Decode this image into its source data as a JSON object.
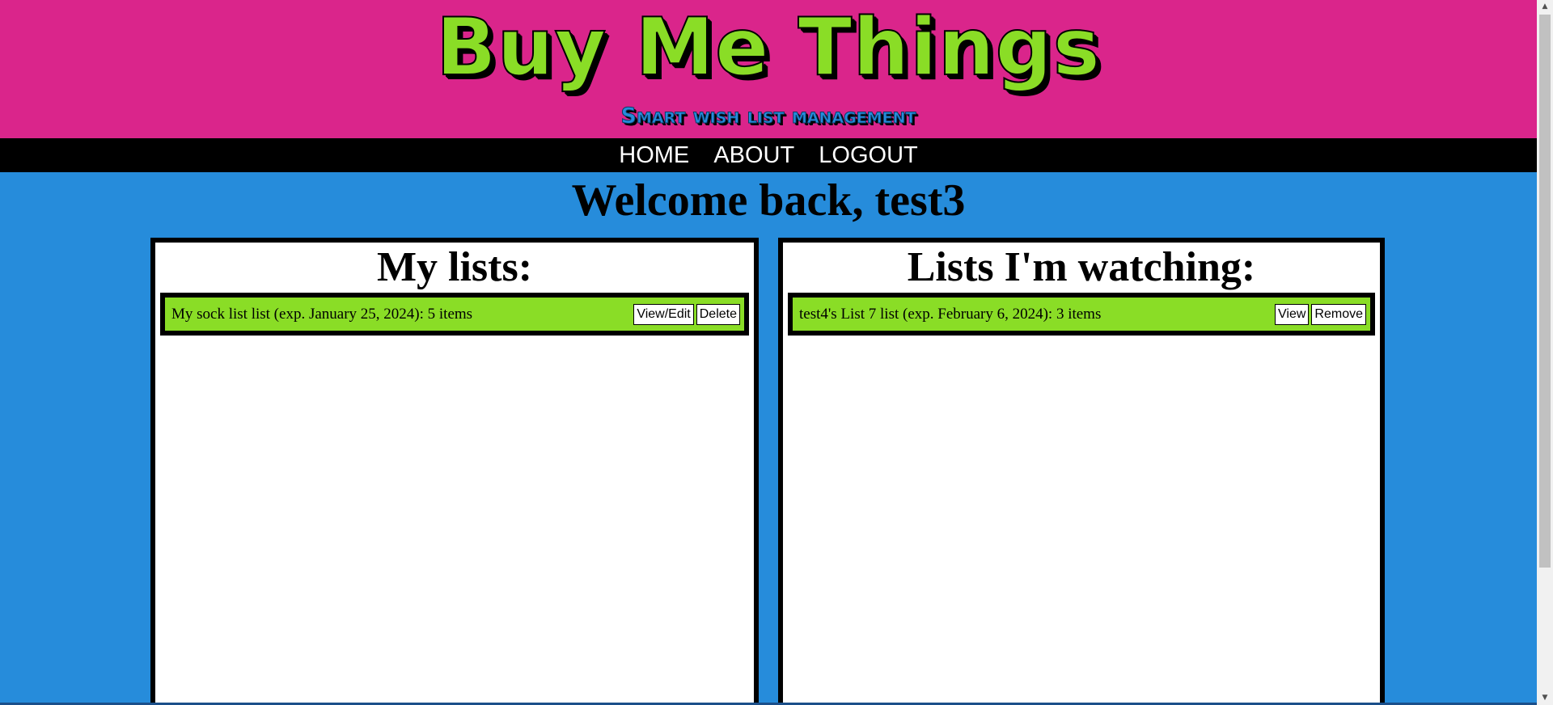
{
  "header": {
    "title": "Buy Me Things",
    "subtitle": "Smart wish list management"
  },
  "nav": {
    "home": "HOME",
    "about": "ABOUT",
    "logout": "LOGOUT"
  },
  "welcome": "Welcome back, test3",
  "my_lists": {
    "heading": "My lists:",
    "items": [
      {
        "text": "My sock list list (exp. January 25, 2024): 5 items",
        "view_edit_label": "View/Edit",
        "delete_label": "Delete"
      }
    ]
  },
  "watching": {
    "heading": "Lists I'm watching:",
    "items": [
      {
        "text": "test4's List 7 list (exp. February 6, 2024): 3 items",
        "view_label": "View",
        "remove_label": "Remove"
      }
    ]
  },
  "colors": {
    "header_bg": "#da258b",
    "accent_green": "#8add26",
    "page_bg": "#268cdb",
    "nav_bg": "#000000"
  },
  "icons": {
    "scroll_up": "arrow-up-icon",
    "scroll_down": "arrow-down-icon"
  }
}
